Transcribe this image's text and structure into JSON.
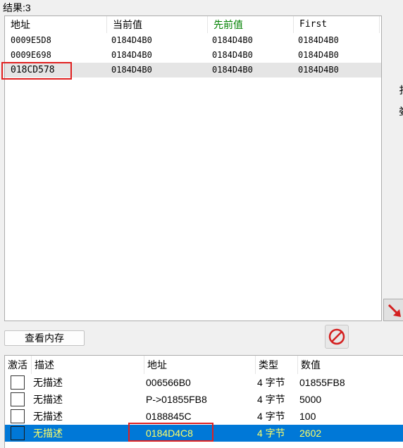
{
  "result_label": "结果:3",
  "scan_results": {
    "columns": [
      "地址",
      "当前值",
      "先前值",
      "First"
    ],
    "previous_column_color": "#008000",
    "rows": [
      {
        "address": "0009E5D8",
        "current": "0184D4B0",
        "previous": "0184D4B0",
        "first": "0184D4B0"
      },
      {
        "address": "0009E698",
        "current": "0184D4B0",
        "previous": "0184D4B0",
        "first": "0184D4B0"
      },
      {
        "address": "018CD578",
        "current": "0184D4B0",
        "previous": "0184D4B0",
        "first": "0184D4B0",
        "selected": true
      }
    ]
  },
  "side_labels": [
    "扌",
    "娄"
  ],
  "buttons": {
    "view_memory": "查看内存",
    "stop_icon": "no-entry-icon",
    "add_to_list_icon": "red-arrow-icon"
  },
  "highlight_color": "#e02020",
  "address_list": {
    "columns": [
      "激活",
      "描述",
      "地址",
      "类型",
      "数值"
    ],
    "selected_row_color": "#0078d7",
    "selected_text_color": "#ffff66",
    "rows": [
      {
        "active": false,
        "description": "无描述",
        "address": "006566B0",
        "type": "4 字节",
        "value": "01855FB8"
      },
      {
        "active": false,
        "description": "无描述",
        "address": "P->01855FB8",
        "type": "4 字节",
        "value": "5000"
      },
      {
        "active": false,
        "description": "无描述",
        "address": "0188845C",
        "type": "4 字节",
        "value": "100"
      },
      {
        "active": false,
        "description": "无描述",
        "address": "0184D4C8",
        "type": "4 字节",
        "value": "2602",
        "selected": true
      }
    ]
  }
}
